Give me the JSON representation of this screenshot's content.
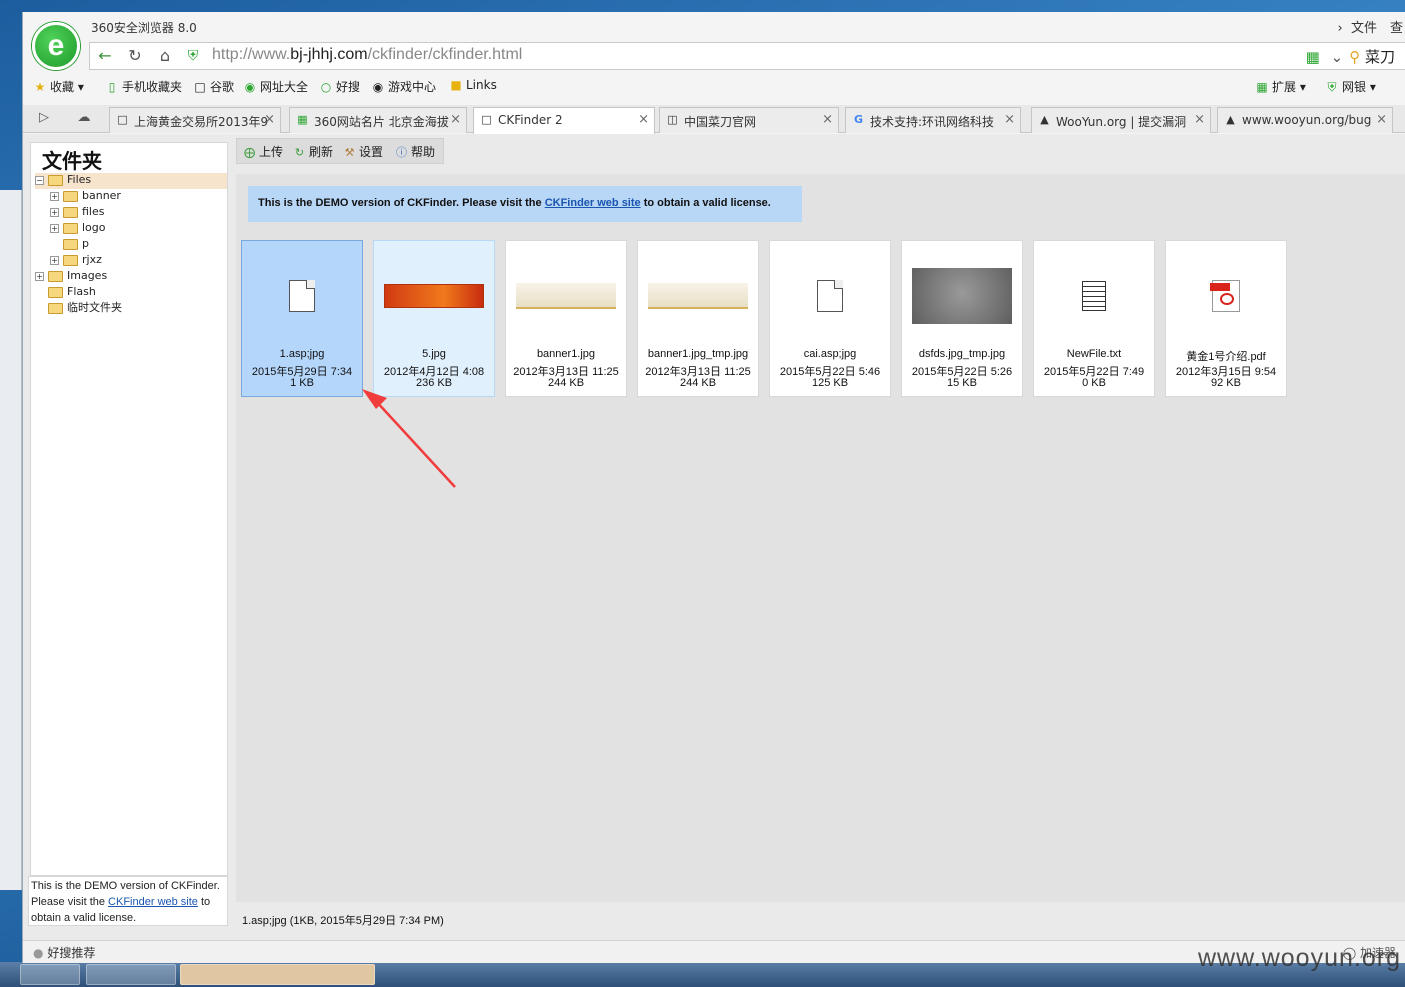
{
  "desktop": {
    "watermark": "www.wooyun.org"
  },
  "window": {
    "title": "360安全浏览器 8.0",
    "menu_file": "文件",
    "menu_view": "查"
  },
  "address": {
    "url_prefix": "http://www.",
    "url_domain": "bj-jhhj.com",
    "url_path": "/ckfinder/ckfinder.html",
    "search_text": "菜刀"
  },
  "bookmarks": {
    "items": [
      {
        "label": "收藏",
        "icon": "star-icon"
      },
      {
        "label": "手机收藏夹",
        "icon": "phone-icon"
      },
      {
        "label": "谷歌",
        "icon": "page-icon"
      },
      {
        "label": "网址大全",
        "icon": "globe-icon"
      },
      {
        "label": "好搜",
        "icon": "search-icon"
      },
      {
        "label": "游戏中心",
        "icon": "gamepad-icon"
      },
      {
        "label": "Links",
        "icon": "folder-icon"
      }
    ],
    "extensions": "扩展",
    "netbank": "网银"
  },
  "tabs": [
    {
      "label": "上海黄金交易所2013年9",
      "active": false
    },
    {
      "label": "360网站名片 北京金海拔",
      "active": false
    },
    {
      "label": "CKFinder 2",
      "active": true
    },
    {
      "label": "中国菜刀官网",
      "active": false
    },
    {
      "label": "技术支持:环讯网络科技",
      "active": false
    },
    {
      "label": "WooYun.org | 提交漏洞",
      "active": false
    },
    {
      "label": "www.wooyun.org/bug",
      "active": false
    }
  ],
  "folders": {
    "title": "文件夹",
    "tree": [
      {
        "label": "Files",
        "level": 0,
        "toggle": "−",
        "selected": true
      },
      {
        "label": "banner",
        "level": 1,
        "toggle": "+"
      },
      {
        "label": "files",
        "level": 1,
        "toggle": "+"
      },
      {
        "label": "logo",
        "level": 1,
        "toggle": "+"
      },
      {
        "label": "p",
        "level": 1,
        "toggle": ""
      },
      {
        "label": "rjxz",
        "level": 1,
        "toggle": "+"
      },
      {
        "label": "Images",
        "level": 0,
        "toggle": "+"
      },
      {
        "label": "Flash",
        "level": 0,
        "toggle": ""
      },
      {
        "label": "临时文件夹",
        "level": 0,
        "toggle": ""
      }
    ],
    "license_prefix": "This is the DEMO version of CKFinder. Please visit the ",
    "license_link": "CKFinder web site",
    "license_suffix": " to obtain a valid license."
  },
  "toolbar": {
    "upload": "上传",
    "refresh": "刷新",
    "settings": "设置",
    "help": "帮助"
  },
  "banner": {
    "prefix": "This is the DEMO version of CKFinder. Please visit the ",
    "link": "CKFinder web site",
    "suffix": " to obtain a valid license."
  },
  "files": [
    {
      "name": "1.asp;jpg",
      "date": "2015年5月29日 7:34",
      "size": "1 KB",
      "thumb": "doc",
      "state": "selected"
    },
    {
      "name": "5.jpg",
      "date": "2012年4月12日 4:08",
      "size": "236 KB",
      "thumb": "banner-red",
      "state": "hover"
    },
    {
      "name": "banner1.jpg",
      "date": "2012年3月13日 11:25",
      "size": "244 KB",
      "thumb": "banner-light",
      "state": ""
    },
    {
      "name": "banner1.jpg_tmp.jpg",
      "date": "2012年3月13日 11:25",
      "size": "244 KB",
      "thumb": "banner-light",
      "state": ""
    },
    {
      "name": "cai.asp;jpg",
      "date": "2015年5月22日 5:46",
      "size": "125 KB",
      "thumb": "doc",
      "state": ""
    },
    {
      "name": "dsfds.jpg_tmp.jpg",
      "date": "2015年5月22日 5:26",
      "size": "15 KB",
      "thumb": "gray-photo",
      "state": ""
    },
    {
      "name": "NewFile.txt",
      "date": "2015年5月22日 7:49",
      "size": "0 KB",
      "thumb": "txt",
      "state": ""
    },
    {
      "name": "黄金1号介绍.pdf",
      "date": "2012年3月15日 9:54",
      "size": "92 KB",
      "thumb": "pdf",
      "state": ""
    }
  ],
  "status_line": "1.asp;jpg (1KB, 2015年5月29日 7:34 PM)",
  "browser_status": {
    "left": "好搜推荐",
    "right": "加速器"
  },
  "colors": {
    "selected_tile": "#b5d6fb",
    "banner_bg": "#b8d6f6",
    "arrow": "#f03c3c"
  }
}
